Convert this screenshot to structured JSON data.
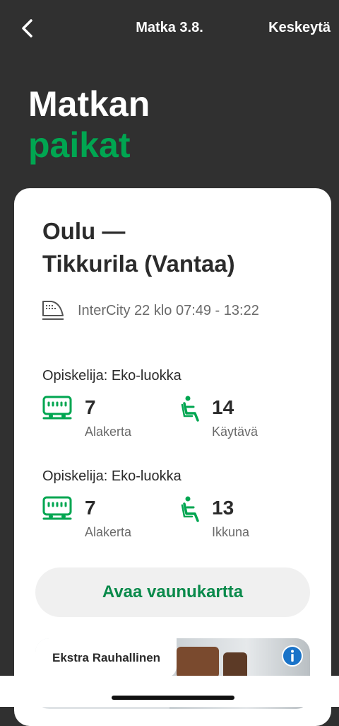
{
  "header": {
    "title": "Matka 3.8.",
    "cancel_label": "Keskeytä",
    "back_icon": "chevron-left-icon"
  },
  "heading": {
    "line1": "Matkan",
    "line2": "paikat"
  },
  "trip": {
    "route_line1": "Oulu —",
    "route_line2": "Tikkurila (Vantaa)",
    "train_icon": "train-icon",
    "train_info": "InterCity 22 klo 07:49 - 13:22"
  },
  "seats": [
    {
      "class_label": "Opiskelija: Eko-luokka",
      "car_number": "7",
      "car_floor": "Alakerta",
      "seat_number": "14",
      "seat_type": "Käytävä"
    },
    {
      "class_label": "Opiskelija: Eko-luokka",
      "car_number": "7",
      "car_floor": "Alakerta",
      "seat_number": "13",
      "seat_type": "Ikkuna"
    }
  ],
  "actions": {
    "open_car_map": "Avaa vaunukartta"
  },
  "promo": {
    "label": "Ekstra Rauhallinen",
    "info_icon": "info-icon"
  },
  "colors": {
    "accent_green": "#00a651",
    "button_green_text": "#0a8a4b",
    "background": "#303030",
    "info_blue": "#1a73c8"
  }
}
